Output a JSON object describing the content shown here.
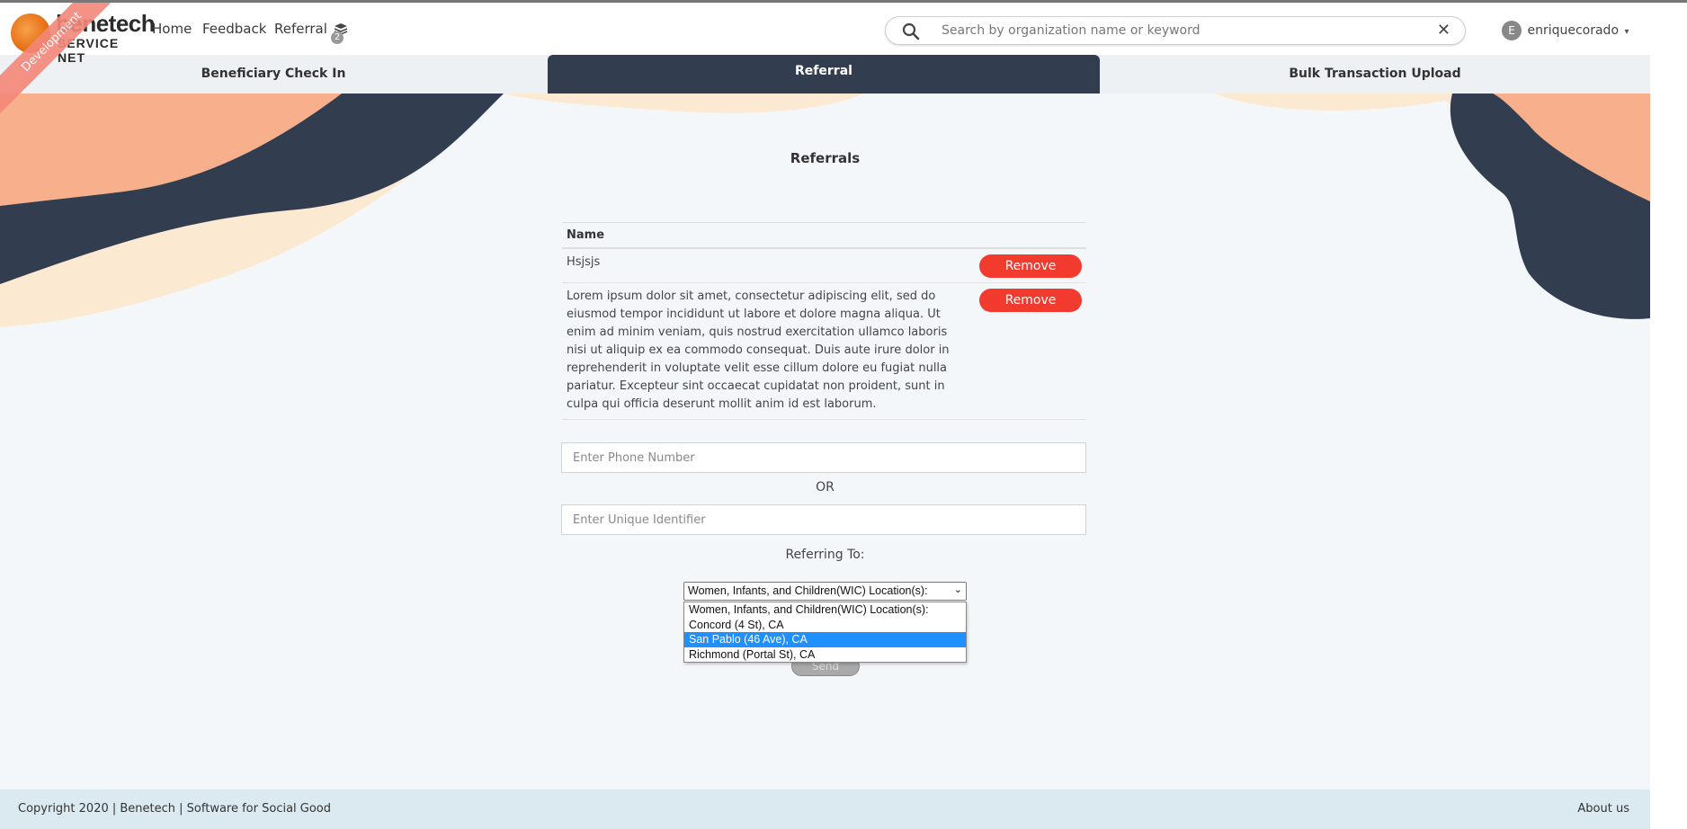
{
  "header": {
    "logo": {
      "word": "benetech",
      "sub": "SERVICE NET"
    },
    "ribbon_label": "Development",
    "nav": [
      {
        "label": "Home"
      },
      {
        "label": "Feedback"
      },
      {
        "label": "Referral"
      }
    ],
    "referral_badge": "2",
    "search": {
      "placeholder": "Search by organization name or keyword",
      "value": ""
    },
    "user": {
      "avatar_letter": "E",
      "name": "enriquecorado"
    }
  },
  "tabs": [
    {
      "label": "Beneficiary Check In",
      "active": false
    },
    {
      "label": "Referral",
      "active": true
    },
    {
      "label": "Bulk Transaction Upload",
      "active": false
    }
  ],
  "main": {
    "title": "Referrals",
    "table": {
      "header": "Name",
      "rows": [
        {
          "name": "Hsjsjs",
          "action": "Remove"
        },
        {
          "name": "Lorem ipsum dolor sit amet, consectetur adipiscing elit, sed do eiusmod tempor incididunt ut labore et dolore magna aliqua. Ut enim ad minim veniam, quis nostrud exercitation ullamco laboris nisi ut aliquip ex ea commodo consequat. Duis aute irure dolor in reprehenderit in voluptate velit esse cillum dolore eu fugiat nulla pariatur. Excepteur sint occaecat cupidatat non proident, sunt in culpa qui officia deserunt mollit anim id est laborum.",
          "action": "Remove"
        }
      ]
    },
    "phone_field": {
      "placeholder": "Enter Phone Number",
      "value": ""
    },
    "or_label": "OR",
    "identifier_field": {
      "placeholder": "Enter Unique Identifier",
      "value": ""
    },
    "referring_label": "Referring To:",
    "referring_select": {
      "value": "Women, Infants, and Children(WIC) Location(s):",
      "options": [
        "Women, Infants, and Children(WIC) Location(s):",
        "Concord (4 St), CA",
        "San Pablo (46 Ave), CA",
        "Richmond (Portal St), CA"
      ],
      "highlighted": "San Pablo (46 Ave), CA"
    },
    "send_label": "Send"
  },
  "footer": {
    "copyright": "Copyright 2020 | Benetech | Software for Social Good",
    "about": "About us"
  },
  "colors": {
    "tab_active_bg": "#323e50",
    "remove_red": "#f23a2f",
    "peach": "#f7b08b",
    "navy": "#323e50",
    "cream": "#fbe9d2",
    "footer_bg": "#dbe9f1",
    "option_highlight": "#1e90ff"
  }
}
